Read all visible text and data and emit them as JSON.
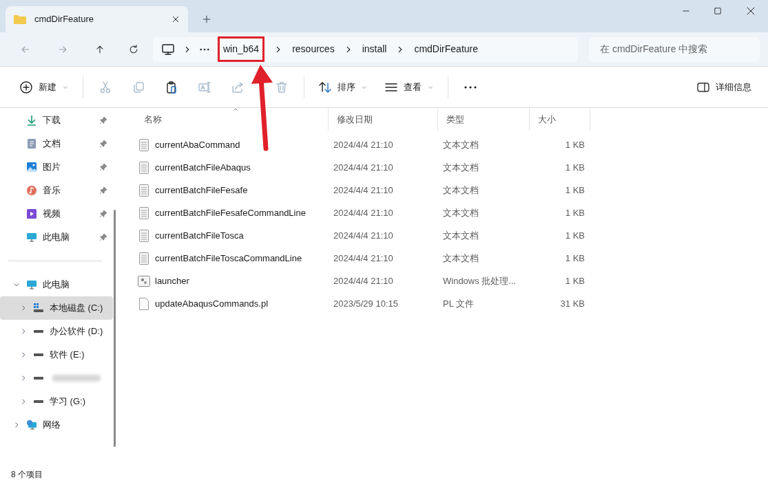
{
  "tabs": [
    {
      "label": "cmdDirFeature",
      "selected": true
    }
  ],
  "breadcrumb": [
    {
      "label": "win_b64",
      "highlighted": true
    },
    {
      "label": "resources",
      "highlighted": false
    },
    {
      "label": "install",
      "highlighted": false
    },
    {
      "label": "cmdDirFeature",
      "highlighted": false
    }
  ],
  "search": {
    "placeholder": "在 cmdDirFeature 中搜索"
  },
  "toolbar": [
    {
      "kind": "new",
      "label": "新建",
      "disabled": false
    },
    {
      "kind": "cut",
      "disabled": true
    },
    {
      "kind": "copy",
      "disabled": true
    },
    {
      "kind": "paste",
      "disabled": false
    },
    {
      "kind": "rename",
      "disabled": true
    },
    {
      "kind": "share",
      "disabled": true
    },
    {
      "kind": "delete",
      "disabled": true
    },
    {
      "kind": "sort",
      "label": "排序",
      "disabled": false
    },
    {
      "kind": "view",
      "label": "查看",
      "disabled": false
    },
    {
      "kind": "more"
    }
  ],
  "details_button": "详细信息",
  "quick_access": [
    {
      "kind": "download",
      "label": "下载",
      "pinned": true
    },
    {
      "kind": "docs",
      "label": "文档",
      "pinned": true
    },
    {
      "kind": "pictures",
      "label": "图片",
      "pinned": true
    },
    {
      "kind": "music",
      "label": "音乐",
      "pinned": true
    },
    {
      "kind": "video",
      "label": "视频",
      "pinned": true
    },
    {
      "kind": "pc",
      "label": "此电脑",
      "pinned": true
    }
  ],
  "tree": [
    {
      "kind": "pc",
      "label": "此电脑",
      "expanded": true,
      "selected": false,
      "children": [
        {
          "kind": "system",
          "label": "本地磁盘 (C:)",
          "expanded": false,
          "selected": true
        },
        {
          "kind": "drive",
          "label": "办公软件 (D:)",
          "expanded": false,
          "selected": false
        },
        {
          "kind": "drive",
          "label": "软件 (E:)",
          "expanded": false,
          "selected": false
        },
        {
          "kind": "blurred",
          "expanded": false,
          "selected": false
        },
        {
          "kind": "drive",
          "label": "学习 (G:)",
          "expanded": false,
          "selected": false
        }
      ]
    },
    {
      "kind": "network",
      "label": "网络",
      "expanded": false,
      "selected": false
    }
  ],
  "table": {
    "columns": [
      {
        "label": "名称",
        "sorted": true
      },
      {
        "label": "修改日期",
        "sorted": false
      },
      {
        "label": "类型",
        "sorted": false
      },
      {
        "label": "大小",
        "sorted": false
      }
    ],
    "rows": [
      {
        "kind": "text",
        "name": "currentAbaCommand",
        "date": "2024/4/4 21:10",
        "type": "文本文档",
        "size": "1 KB"
      },
      {
        "kind": "text",
        "name": "currentBatchFileAbaqus",
        "date": "2024/4/4 21:10",
        "type": "文本文档",
        "size": "1 KB"
      },
      {
        "kind": "text",
        "name": "currentBatchFileFesafe",
        "date": "2024/4/4 21:10",
        "type": "文本文档",
        "size": "1 KB"
      },
      {
        "kind": "text",
        "name": "currentBatchFileFesafeCommandLine",
        "date": "2024/4/4 21:10",
        "type": "文本文档",
        "size": "1 KB"
      },
      {
        "kind": "text",
        "name": "currentBatchFileTosca",
        "date": "2024/4/4 21:10",
        "type": "文本文档",
        "size": "1 KB"
      },
      {
        "kind": "text",
        "name": "currentBatchFileToscaCommandLine",
        "date": "2024/4/4 21:10",
        "type": "文本文档",
        "size": "1 KB"
      },
      {
        "kind": "batch",
        "name": "launcher",
        "date": "2024/4/4 21:10",
        "type": "Windows 批处理...",
        "size": "1 KB"
      },
      {
        "kind": "file",
        "name": "updateAbaqusCommands.pl",
        "date": "2023/5/29 10:15",
        "type": "PL 文件",
        "size": "31 KB"
      }
    ]
  },
  "status_bar": "8 个项目"
}
